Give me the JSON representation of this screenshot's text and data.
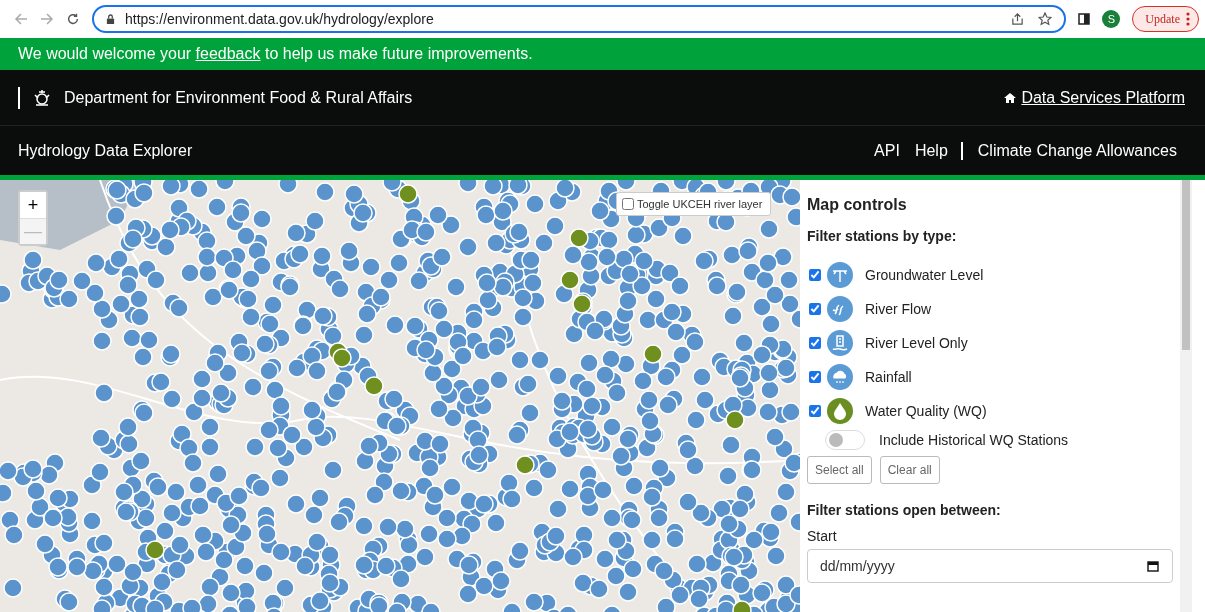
{
  "browser": {
    "url": "https://environment.data.gov.uk/hydrology/explore",
    "profile_initial": "S",
    "update_button": "Update"
  },
  "banner": {
    "before": "We would welcome your ",
    "link": "feedback",
    "after": " to help us make future improvements."
  },
  "header": {
    "department": "Department for Environment Food & Rural Affairs",
    "platform_link": "Data Services Platform"
  },
  "nav": {
    "title": "Hydrology Data Explorer",
    "links": [
      {
        "label": "API",
        "divider_before": false
      },
      {
        "label": "Help",
        "divider_before": false
      },
      {
        "label": "Climate Change Allowances",
        "divider_before": true
      }
    ]
  },
  "map": {
    "zoom_in": "+",
    "zoom_out": "—",
    "zoom_out_disabled": true,
    "river_layer": {
      "label": "Toggle UKCEH river layer",
      "checked": false
    }
  },
  "panel": {
    "title": "Map controls",
    "filter_heading": "Filter stations by type:",
    "station_types": [
      {
        "label": "Groundwater Level",
        "checked": true,
        "kind": "groundwater",
        "color": "#5b9bd5"
      },
      {
        "label": "River Flow",
        "checked": true,
        "kind": "flow",
        "color": "#5b9bd5"
      },
      {
        "label": "River Level Only",
        "checked": true,
        "kind": "level",
        "color": "#5b9bd5"
      },
      {
        "label": "Rainfall",
        "checked": true,
        "kind": "rainfall",
        "color": "#5b9bd5"
      },
      {
        "label": "Water Quality (WQ)",
        "checked": true,
        "kind": "quality",
        "color": "#6b8e23"
      }
    ],
    "historical": {
      "label": "Include Historical WQ Stations",
      "on": false
    },
    "buttons": [
      "Select all",
      "Clear all"
    ],
    "date_heading": "Filter stations open between:",
    "start_label": "Start",
    "start_placeholder": "dd/mm/yyyy"
  }
}
